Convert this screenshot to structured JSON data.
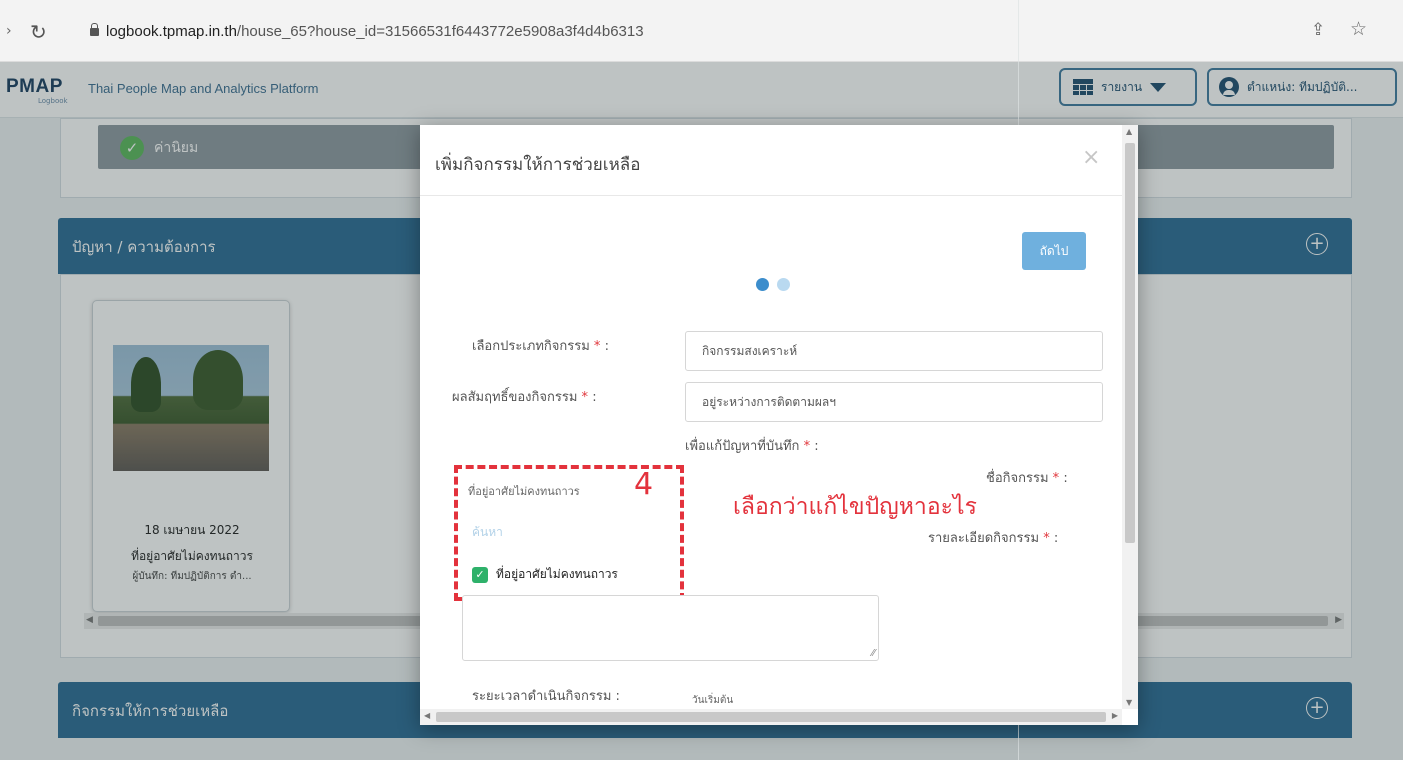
{
  "browser": {
    "url_host": "logbook.tpmap.in.th",
    "url_path": "/house_65?house_id=31566531f6443772e5908a3f4d4b6313"
  },
  "app": {
    "logo": "PMAP",
    "logo_sub": "Logbook",
    "subtitle": "Thai People Map and Analytics Platform",
    "report_label": "รายงาน",
    "position_label": "ตำแหน่ง: ทีมปฏิบัติ..."
  },
  "background": {
    "value_label": "ค่านิยม",
    "problem_section_title": "ปัญหา / ความต้องการ",
    "activity_section_title": "กิจกรรมให้การช่วยเหลือ",
    "card": {
      "date": "18 เมษายน 2022",
      "title": "ที่อยู่อาศัยไม่คงทนถาวร",
      "recorder": "ผู้บันทึก: ทีมปฏิบัติการ ตำ..."
    }
  },
  "modal": {
    "title": "เพิ่มกิจกรรมให้การช่วยเหลือ",
    "close_symbol": "×",
    "next_label": "ถัดไป",
    "activity_type_label": "เลือกประเภทกิจกรรม",
    "activity_type_value": "กิจกรรมสงเคราะห์",
    "outcome_label": "ผลสัมฤทธิ์ของกิจกรรม",
    "outcome_value": "อยู่ระหว่างการติดตามผลฯ",
    "solve_problem_label": "เพื่อแก้ปัญหาที่บันทึก",
    "activity_name_label": "ชื่อกิจกรรม",
    "activity_detail_label": "รายละเอียดกิจกรรม",
    "problem_select_value": "ที่อยู่อาศัยไม่คงทนถาวร",
    "search_text": "ค้นหา",
    "checked_option": "ที่อยู่อาศัยไม่คงทนถาวร",
    "duration_label": "ระยะเวลาดำเนินกิจกรรม :",
    "start_date_label": "วันเริ่มต้น",
    "required_mark": "*",
    "colon": ":"
  },
  "annotation": {
    "step_number": "4",
    "text": "เลือกว่าแก้ไขปัญหาอะไร"
  },
  "colors": {
    "section_bar": "#2b6c95",
    "next_button": "#6fb0de",
    "annotation_red": "#e3323c",
    "checkbox_green": "#2eb16a"
  }
}
